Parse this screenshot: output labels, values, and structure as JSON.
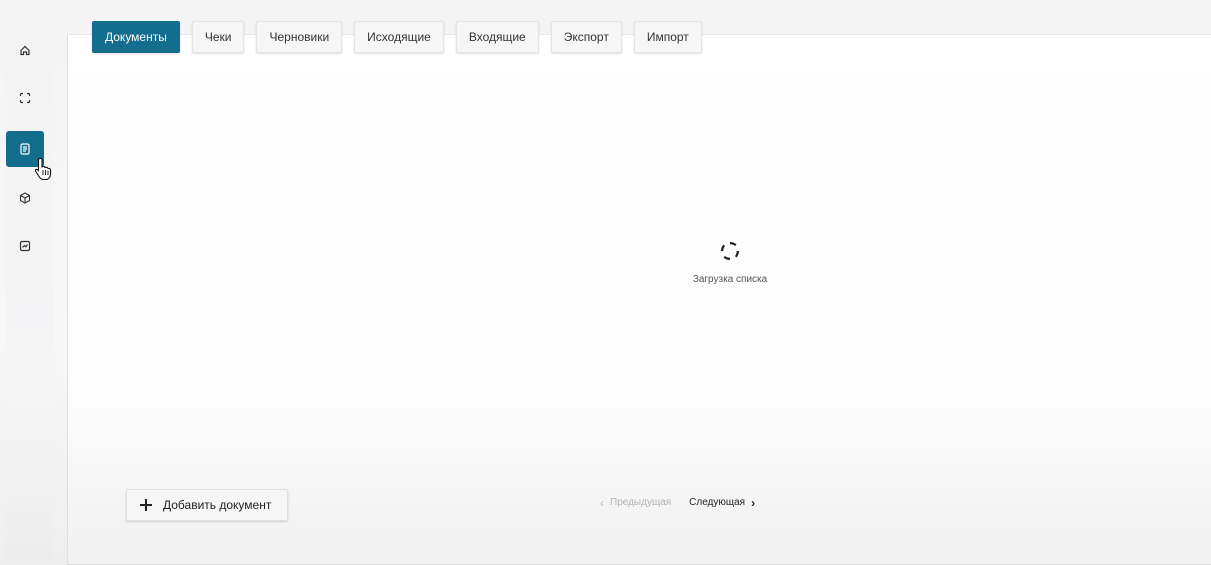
{
  "sidebar": {
    "items": [
      {
        "icon": "home-icon",
        "active": false
      },
      {
        "icon": "scan-icon",
        "active": false
      },
      {
        "icon": "document-icon",
        "active": true
      },
      {
        "icon": "cube-icon",
        "active": false
      },
      {
        "icon": "chart-icon",
        "active": false
      }
    ]
  },
  "tabs": [
    {
      "label": "Документы",
      "active": true
    },
    {
      "label": "Чеки",
      "active": false
    },
    {
      "label": "Черновики",
      "active": false
    },
    {
      "label": "Исходящие",
      "active": false
    },
    {
      "label": "Входящие",
      "active": false
    },
    {
      "label": "Экспорт",
      "active": false
    },
    {
      "label": "Импорт",
      "active": false
    }
  ],
  "loader": {
    "text": "Загрузка списка",
    "icon": "loading-spinner-icon"
  },
  "actions": {
    "add_document": "Добавить документ"
  },
  "pagination": {
    "prev_label": "Предыдущая",
    "next_label": "Следующая",
    "prev_enabled": false,
    "next_enabled": true
  },
  "colors": {
    "accent": "#136e8e",
    "disabled_text": "#b4b4b4"
  }
}
